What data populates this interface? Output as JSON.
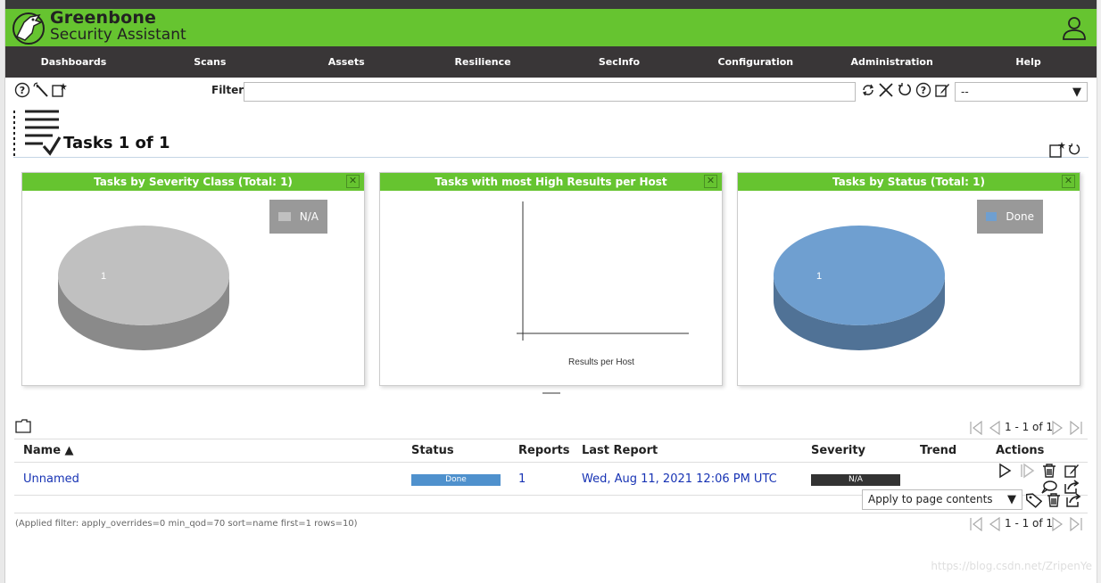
{
  "app": {
    "logo_line1": "Greenbone",
    "logo_line2": "Security Assistant",
    "accent": "#66c430",
    "menubar_bg": "#393637"
  },
  "menu": [
    {
      "label": "Dashboards"
    },
    {
      "label": "Scans"
    },
    {
      "label": "Assets"
    },
    {
      "label": "Resilience"
    },
    {
      "label": "SecInfo"
    },
    {
      "label": "Configuration"
    },
    {
      "label": "Administration"
    },
    {
      "label": "Help"
    }
  ],
  "toolbar": {
    "icons": [
      "help-icon",
      "wizard-icon",
      "new-task-icon"
    ],
    "filter_label": "Filter",
    "filter_value": "",
    "filter_icons": [
      "refresh-filter-icon",
      "clear-filter-icon",
      "reset-filter-icon",
      "filter-help-icon",
      "edit-filter-icon"
    ],
    "filter_select": "--"
  },
  "page": {
    "title": "Tasks 1 of 1"
  },
  "charts": [
    {
      "title": "Tasks by Severity Class (Total: 1)",
      "legend": "N/A",
      "slice_label": "1",
      "color": "#c0c0c0"
    },
    {
      "title": "Tasks with most High Results per Host",
      "xlabel": "Results per Host"
    },
    {
      "title": "Tasks by Status (Total: 1)",
      "legend": "Done",
      "slice_label": "1",
      "color": "#6f9fd0"
    }
  ],
  "chart_data": [
    {
      "type": "pie",
      "title": "Tasks by Severity Class (Total: 1)",
      "categories": [
        "N/A"
      ],
      "values": [
        1
      ],
      "legend": "top-right"
    },
    {
      "type": "bar",
      "title": "Tasks with most High Results per Host",
      "categories": [],
      "values": [],
      "xlabel": "Results per Host"
    },
    {
      "type": "pie",
      "title": "Tasks by Status (Total: 1)",
      "categories": [
        "Done"
      ],
      "values": [
        1
      ],
      "legend": "top-right"
    }
  ],
  "pager": {
    "text": "1 - 1 of 1"
  },
  "table": {
    "headers": {
      "name": "Name ▲",
      "status": "Status",
      "reports": "Reports",
      "last_report": "Last Report",
      "severity": "Severity",
      "trend": "Trend",
      "actions": "Actions"
    },
    "rows": [
      {
        "name": "Unnamed",
        "status": "Done",
        "reports": "1",
        "last_report": "Wed, Aug 11, 2021 12:06 PM UTC",
        "severity": "N/A",
        "trend": ""
      }
    ]
  },
  "bulk": {
    "select": "Apply to page contents"
  },
  "footer": {
    "applied_filter": "(Applied filter: apply_overrides=0 min_qod=70 sort=name first=1 rows=10)",
    "watermark": "https://blog.csdn.net/ZripenYe"
  }
}
